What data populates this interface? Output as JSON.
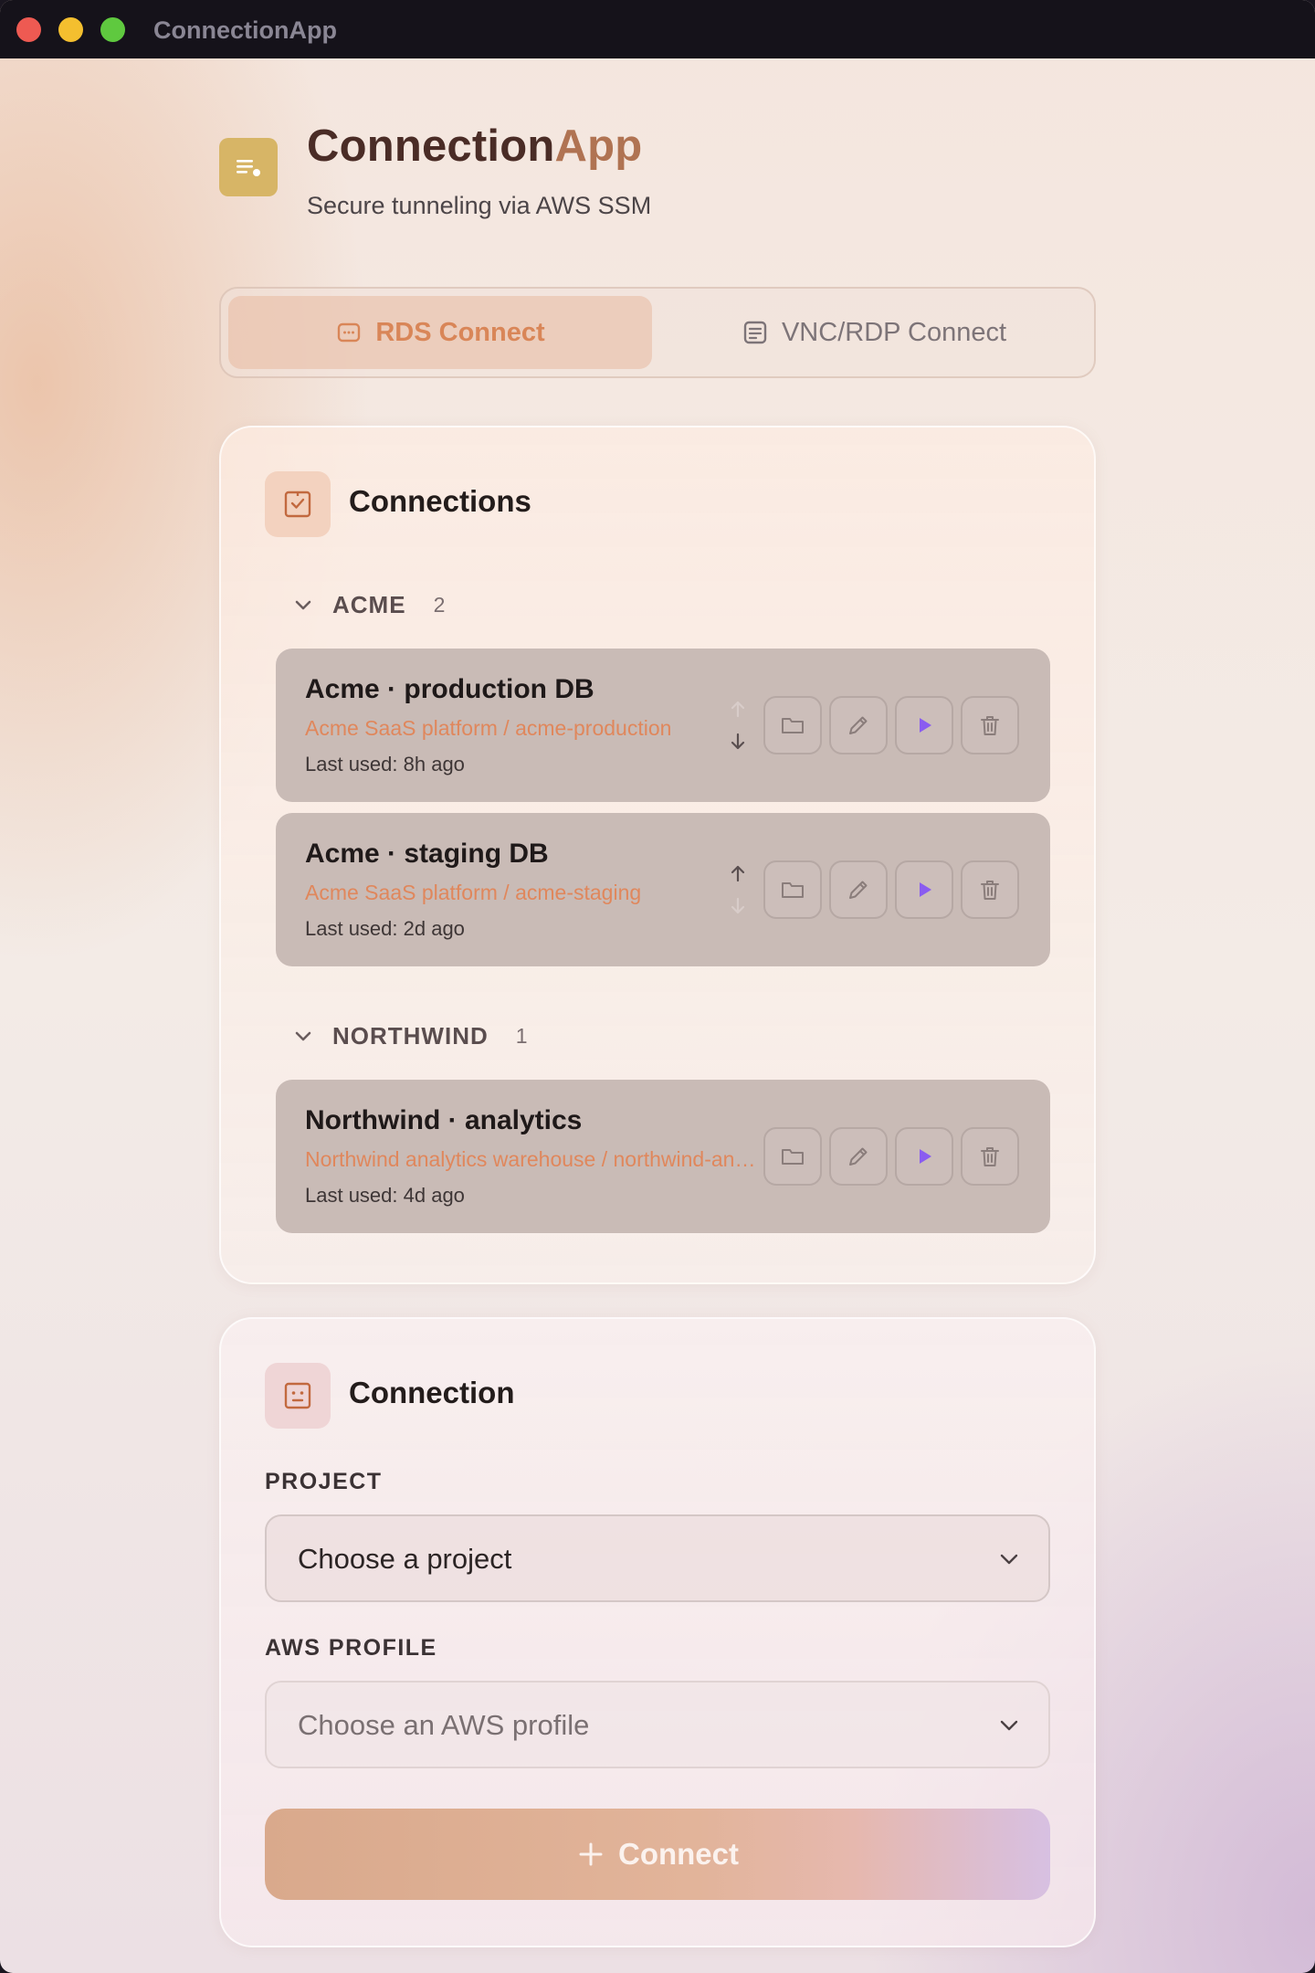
{
  "window": {
    "title": "ConnectionApp"
  },
  "header": {
    "title_main": "Connection",
    "title_accent": "App",
    "subtitle": "Secure tunneling via AWS SSM"
  },
  "tabs": [
    {
      "label": "RDS Connect",
      "active": true,
      "icon": "database-icon"
    },
    {
      "label": "VNC/RDP Connect",
      "active": false,
      "icon": "screen-icon"
    }
  ],
  "connections_card": {
    "title": "Connections",
    "groups": [
      {
        "name": "ACME",
        "count": "2",
        "items": [
          {
            "name": "Acme · production DB",
            "path": "Acme SaaS platform / acme-production",
            "last_used": "Last used: 8h ago"
          },
          {
            "name": "Acme · staging DB",
            "path": "Acme SaaS platform / acme-staging",
            "last_used": "Last used: 2d ago"
          }
        ]
      },
      {
        "name": "NORTHWIND",
        "count": "1",
        "items": [
          {
            "name": "Northwind · analytics",
            "path": "Northwind analytics warehouse / northwind-analytics",
            "last_used": "Last used: 4d ago"
          }
        ]
      }
    ]
  },
  "connection_card": {
    "title": "Connection",
    "project_label": "PROJECT",
    "project_value": "Choose a project",
    "profile_label": "AWS PROFILE",
    "profile_value": "Choose an AWS profile",
    "connect_label": "Connect"
  },
  "colors": {
    "accent": "#d98658",
    "play": "#8a5cf0",
    "row_bg": "#c9bbb6",
    "logo_bg": "#d7b566"
  }
}
